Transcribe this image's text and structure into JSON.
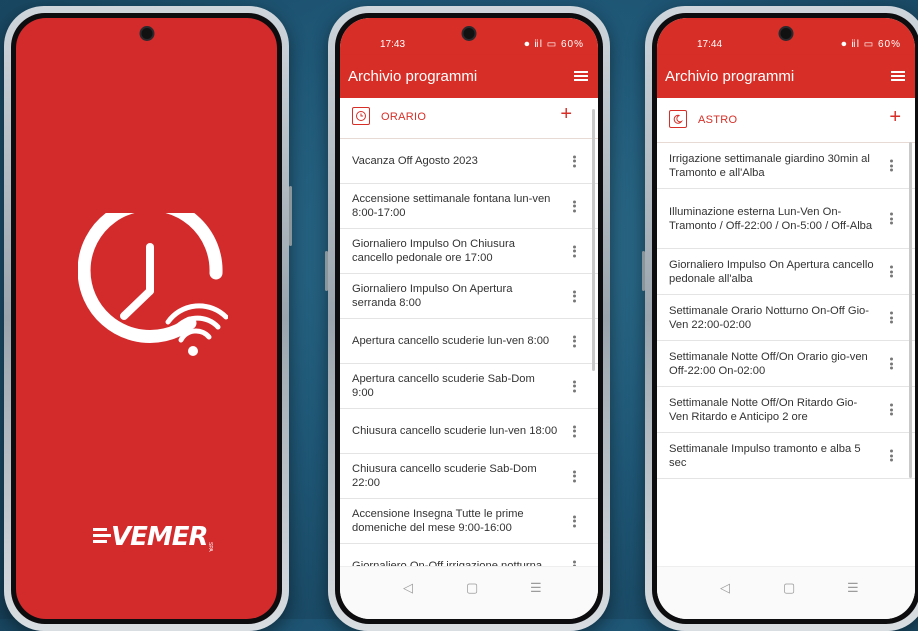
{
  "splash": {
    "brand_name": "VEMER",
    "brand_sub": "SPA",
    "colors": {
      "background": "#d32a2c",
      "foreground": "#ffffff"
    },
    "icons": [
      "clock-icon",
      "wifi-icon"
    ]
  },
  "screen_orario": {
    "status_time": "17:43",
    "status_icons": "⏺ ⅱl ▭ 60%",
    "title": "Archivio programmi",
    "section_label": "ORARIO",
    "section_icon": "clock-icon",
    "add_symbol": "+",
    "items": [
      "Vacanza Off Agosto 2023",
      "Accensione settimanale fontana lun-ven 8:00-17:00",
      "Giornaliero Impulso On Chiusura cancello pedonale ore 17:00",
      "Giornaliero Impulso On Apertura serranda 8:00",
      "Apertura cancello scuderie lun-ven 8:00",
      "Apertura cancello scuderie Sab-Dom 9:00",
      "Chiusura cancello scuderie lun-ven 18:00",
      "Chiusura cancello scuderie Sab-Dom 22:00",
      "Accensione Insegna Tutte le prime domeniche del mese 9:00-16:00",
      "Giornaliero On-Off irrigazione notturna"
    ],
    "nav": {
      "back": "◁",
      "home": "▢",
      "recents": "☰"
    }
  },
  "screen_astro": {
    "status_time": "17:44",
    "status_icons": "⏺ ⅱl ▭ 60%",
    "title": "Archivio programmi",
    "section_label": "ASTRO",
    "section_icon": "moon-sun-icon",
    "add_symbol": "+",
    "items": [
      "Irrigazione settimanale giardino 30min al Tramonto e all'Alba",
      "Illuminazione esterna Lun-Ven On-Tramonto / Off-22:00 / On-5:00 / Off-Alba",
      "Giornaliero Impulso On Apertura cancello pedonale all'alba",
      "Settimanale Orario Notturno On-Off Gio-Ven 22:00-02:00",
      "Settimanale Notte Off/On Orario gio-ven Off-22:00 On-02:00",
      "Settimanale Notte Off/On Ritardo Gio-Ven Ritardo e Anticipo 2 ore",
      "Settimanale Impulso tramonto e alba 5 sec"
    ],
    "nav": {
      "back": "◁",
      "home": "▢",
      "recents": "☰"
    }
  },
  "colors": {
    "accent": "#d72f27",
    "text": "#333333",
    "divider": "#e4e4e4"
  }
}
